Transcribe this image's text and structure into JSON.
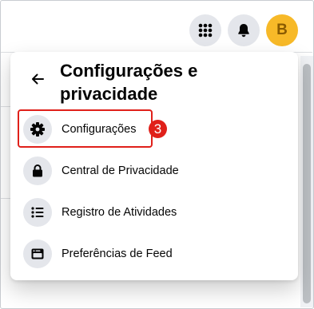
{
  "topbar": {
    "menu_icon": "grid-menu-icon",
    "notifications_icon": "bell-icon",
    "avatar_letter": "B",
    "avatar_color": "#f7b928"
  },
  "panel": {
    "title": "Configurações e privacidade",
    "back_icon": "arrow-left-icon",
    "items": [
      {
        "label": "Configurações",
        "icon": "gear-icon"
      },
      {
        "label": "Central de Privacidade",
        "icon": "lock-icon"
      },
      {
        "label": "Registro de Atividades",
        "icon": "list-icon"
      },
      {
        "label": "Preferências de Feed",
        "icon": "feed-icon"
      }
    ]
  },
  "annotation": {
    "step_number": "3",
    "color": "#e0201a"
  }
}
